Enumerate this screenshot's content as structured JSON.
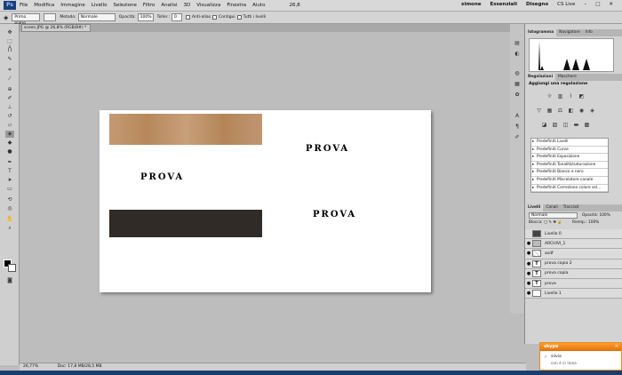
{
  "menubar": {
    "logo": "Ps",
    "items": [
      "File",
      "Modifica",
      "Immagine",
      "Livello",
      "Selezione",
      "Filtro",
      "Analisi",
      "3D",
      "Visualizza",
      "Finestra",
      "Aiuto"
    ],
    "zoom": "26,8",
    "user": "simone",
    "workspace": "Essenziali",
    "drawing": "Disegno",
    "cslive": "CS Live"
  },
  "options": {
    "mode_label": "Primo piano",
    "method_label": "Metodo:",
    "method_value": "Normale",
    "opacity_label": "Opacità:",
    "opacity_value": "100%",
    "tolerance_label": "Toller.:",
    "tolerance_value": "0",
    "antialias_label": "Anti-alias",
    "contiguous_label": "Contigui",
    "all_layers_label": "Tutti i livelli"
  },
  "document": {
    "tab_label": "sceen.JPG @ 26,8% (RGB/8#) *",
    "prova_1": "PROVA",
    "prova_2": "PROVA",
    "prova_3": "PROVA"
  },
  "status": {
    "zoom": "26,77%",
    "doc_info": "Doc: 17,8 MB/28,5 MB"
  },
  "panels": {
    "top_tabs": [
      "Istogramma",
      "Navigatore",
      "Info"
    ],
    "adj_tabs": [
      "Regolazioni",
      "Maschere"
    ],
    "adj_title": "Aggiungi una regolazione",
    "presets": [
      "Predefiniti Livelli",
      "Predefiniti Curve",
      "Predefiniti Esposizione",
      "Predefiniti Tonalità/saturazione",
      "Predefiniti Bianco e nero",
      "Predefiniti Miscelatore canale",
      "Predefiniti Correzione colore sel..."
    ],
    "layer_tabs": [
      "Livelli",
      "Canali",
      "Tracciati"
    ],
    "blend_mode": "Normale",
    "opacity_label": "Opacità:",
    "opacity_value": "100%",
    "lock_label": "Blocca:",
    "fill_label": "Riemp.:",
    "fill_value": "100%",
    "layers": [
      {
        "name": "Livello 0",
        "thumb": "",
        "eye": ""
      },
      {
        "name": "ARCHIVI_1",
        "thumb": "",
        "eye": "●"
      },
      {
        "name": "asdf",
        "thumb": "",
        "eye": "●"
      },
      {
        "name": "prova copia 2",
        "thumb": "T",
        "eye": "●"
      },
      {
        "name": "prova copia",
        "thumb": "T",
        "eye": "●"
      },
      {
        "name": "prova",
        "thumb": "T",
        "eye": "●"
      },
      {
        "name": "Livello 1",
        "thumb": "",
        "eye": "●"
      }
    ]
  },
  "skype": {
    "title": "skype",
    "contact": "silvia",
    "status": "con è in linea"
  }
}
